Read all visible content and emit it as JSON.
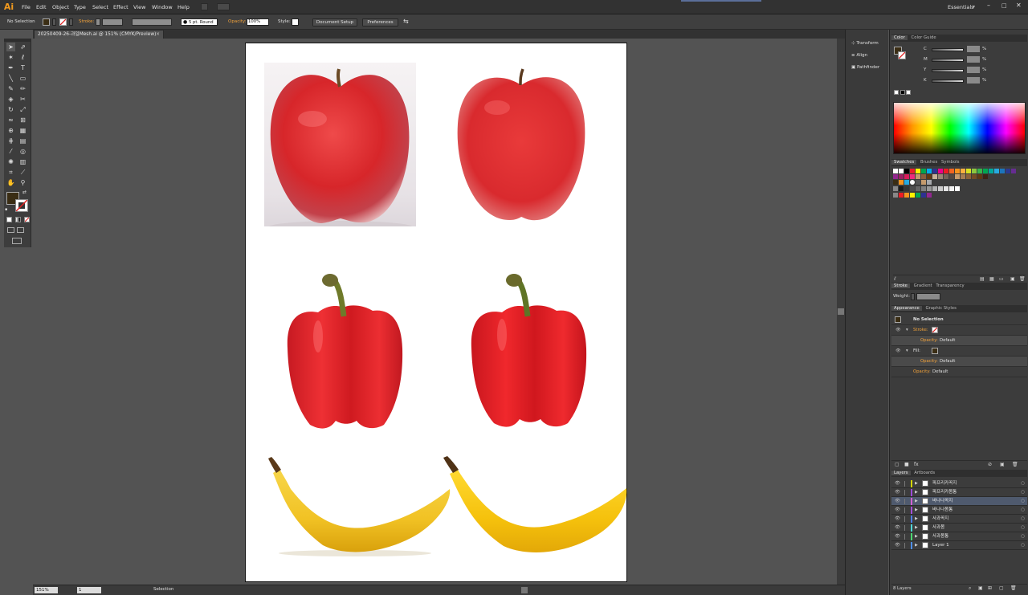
{
  "app": {
    "logo": "Ai",
    "workspace": "Essentials"
  },
  "menu": [
    "File",
    "Edit",
    "Object",
    "Type",
    "Select",
    "Effect",
    "View",
    "Window",
    "Help"
  ],
  "control": {
    "selection": "No Selection",
    "stroke_label": "Stroke:",
    "brush": "5 pt. Round",
    "opacity_label": "Opacity:",
    "opacity_value": "100%",
    "style_label": "Style:",
    "document_setup": "Document Setup",
    "preferences": "Preferences"
  },
  "document": {
    "tab": "20250409-26-과일Mesh.ai @ 151% (CMYK/Preview)",
    "close": "×"
  },
  "status": {
    "zoom": "151%",
    "artboard": "1",
    "tool": "Selection"
  },
  "dock": {
    "items": [
      "Transform",
      "Align",
      "Pathfinder"
    ]
  },
  "color_panel": {
    "tabs": [
      "Color",
      "Color Guide"
    ],
    "channels": [
      {
        "name": "C",
        "unit": "%"
      },
      {
        "name": "M",
        "unit": "%"
      },
      {
        "name": "Y",
        "unit": "%"
      },
      {
        "name": "K",
        "unit": "%"
      }
    ]
  },
  "swatches_panel": {
    "tabs": [
      "Swatches",
      "Brushes",
      "Symbols"
    ]
  },
  "stroke_panel": {
    "tabs": [
      "Stroke",
      "Gradient",
      "Transparency"
    ],
    "weight_label": "Weight:"
  },
  "appearance_panel": {
    "tabs": [
      "Appearance",
      "Graphic Styles"
    ],
    "title": "No Selection",
    "stroke_label": "Stroke:",
    "fill_label": "Fill:",
    "opacity_label": "Opacity:",
    "opacity_value": "Default"
  },
  "layers_panel": {
    "tabs": [
      "Layers",
      "Artboards"
    ],
    "count": "8 Layers",
    "layers": [
      {
        "name": "파프리카꼭지",
        "color": "#d4d400",
        "selected": false
      },
      {
        "name": "파프리카몸통",
        "color": "#9b4bd8",
        "selected": false
      },
      {
        "name": "바나나꼭지",
        "color": "#d45fd4",
        "selected": true
      },
      {
        "name": "바나나몸통",
        "color": "#a64fd8",
        "selected": false
      },
      {
        "name": "사과꼭지",
        "color": "#4f7fe8",
        "selected": false
      },
      {
        "name": "사과몸",
        "color": "#4fd8d8",
        "selected": false
      },
      {
        "name": "사과몸통",
        "color": "#4ad870",
        "selected": false
      },
      {
        "name": "Layer 1",
        "color": "#4f8fe8",
        "selected": false
      }
    ]
  }
}
